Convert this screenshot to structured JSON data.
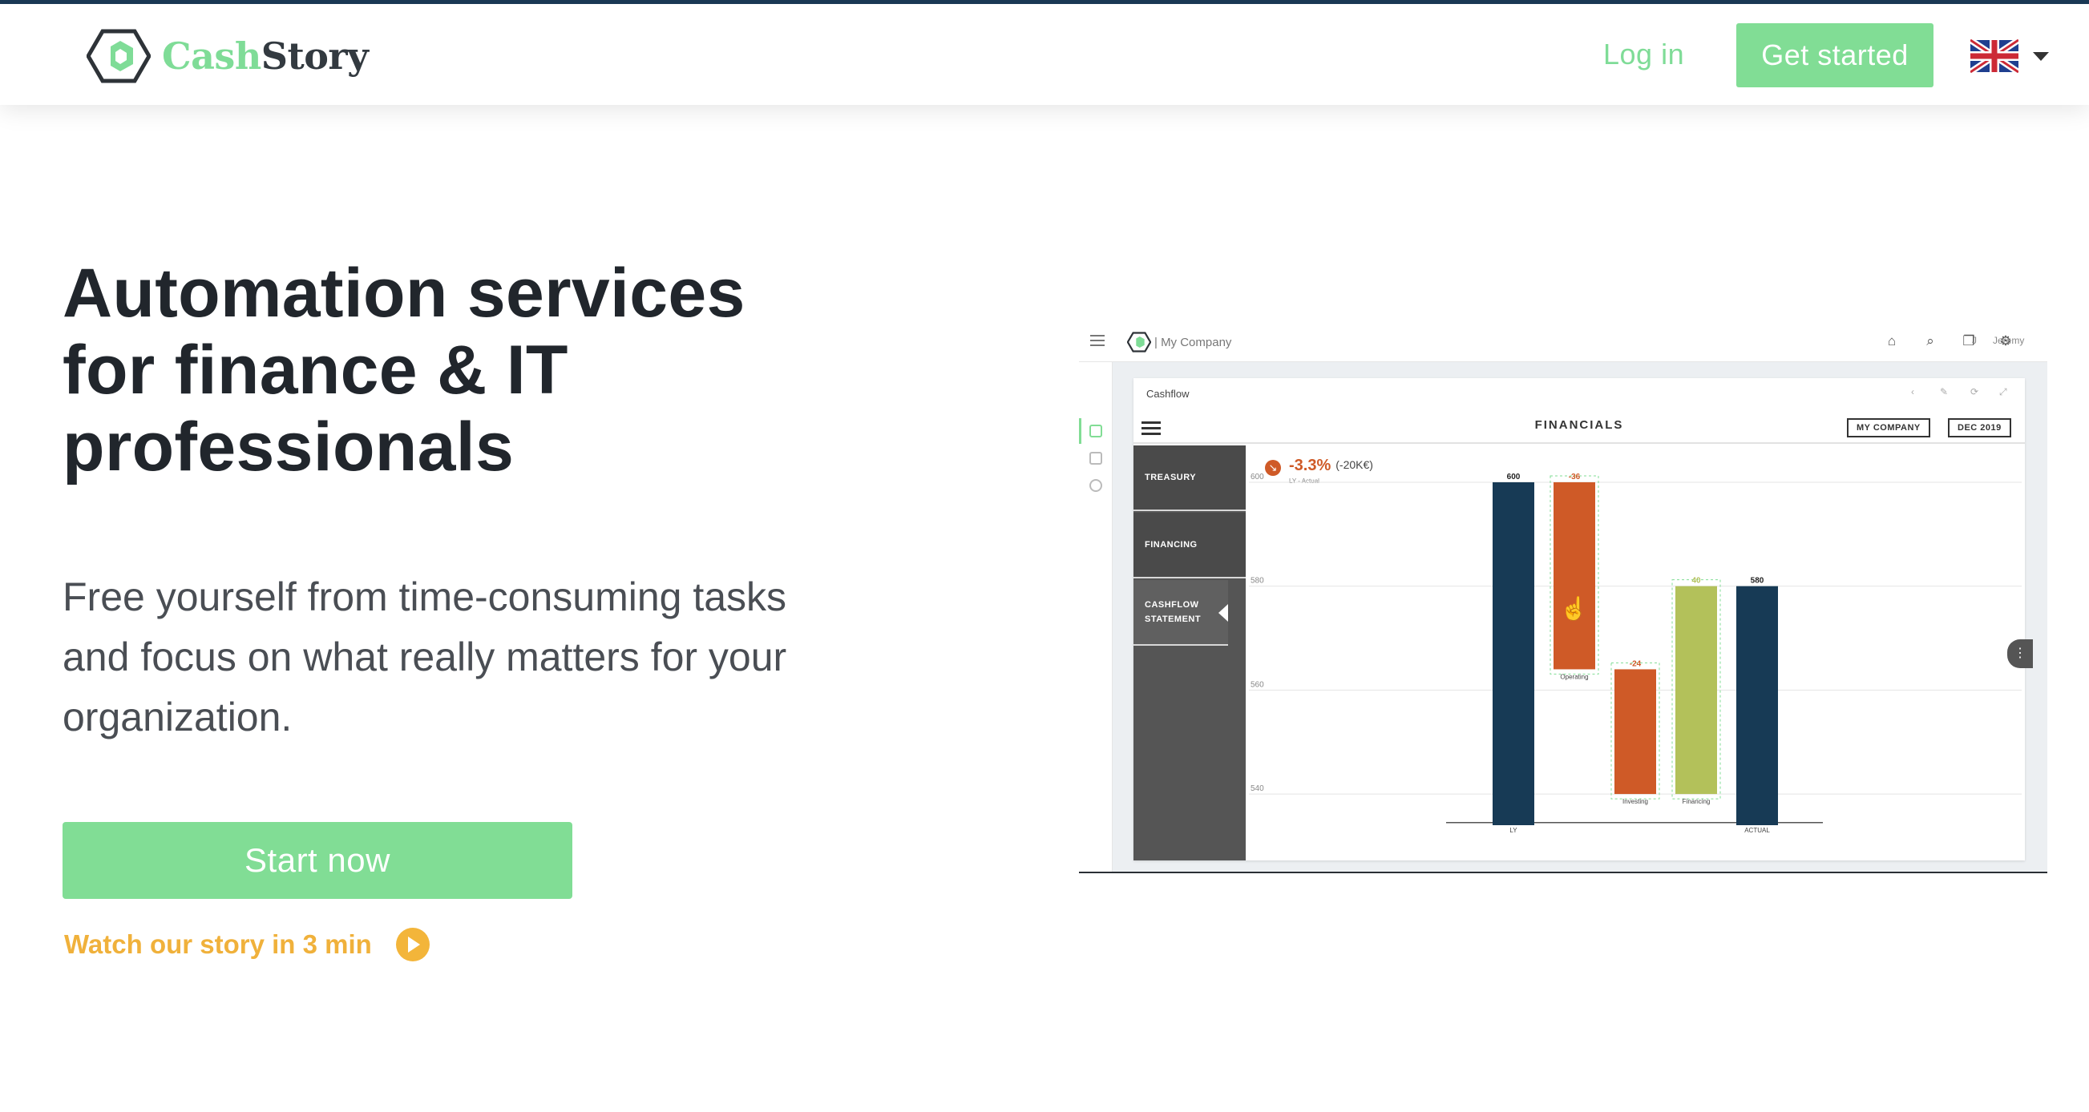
{
  "nav": {
    "logo_word_1": "Cash",
    "logo_word_2": "Story",
    "login": "Log in",
    "get_started": "Get started",
    "language": "English (UK flag)"
  },
  "hero": {
    "title": "Automation services for finance & IT professionals",
    "subtitle": "Free yourself from time-consuming tasks and focus on what really matters for your organization.",
    "cta": "Start now",
    "watch": "Watch our story in 3 min"
  },
  "colors": {
    "accent_green": "#81dd95",
    "accent_orange": "#f0b13b",
    "navy": "#1b3a57",
    "bar_orange": "#cf5a27",
    "bar_olive": "#b3c15a"
  },
  "mockup": {
    "company": "| My Company",
    "user": "Jeremy",
    "user_initial": "J",
    "panel_title": "Cashflow",
    "dashboard_title": "FINANCIALS",
    "selector_company": "MY COMPANY",
    "selector_period": "DEC 2019",
    "side_items": [
      "TREASURY",
      "FINANCING",
      "CASHFLOW STATEMENT"
    ],
    "kpi_value": "-3.3%",
    "kpi_abs": "(-20K€)",
    "kpi_sub": "LY - Actual",
    "icons": [
      "home-icon",
      "search-icon",
      "copy-icon",
      "gear-icon"
    ]
  },
  "chart_data": {
    "type": "bar",
    "subtype": "waterfall",
    "categories": [
      "LY",
      "Operating",
      "Investing",
      "Financing",
      "ACTUAL"
    ],
    "values": [
      600,
      -36,
      -24,
      40,
      580
    ],
    "labels": [
      "600",
      "-36",
      "-24",
      "40",
      "580"
    ],
    "bar_types": [
      "total",
      "delta",
      "delta",
      "delta",
      "total"
    ],
    "colors": [
      "#173a55",
      "#cf5a27",
      "#cf5a27",
      "#b3c15a",
      "#173a55"
    ],
    "y_ticks": [
      540,
      560,
      580,
      600
    ],
    "ylim": [
      534,
      604
    ],
    "grid": true
  }
}
